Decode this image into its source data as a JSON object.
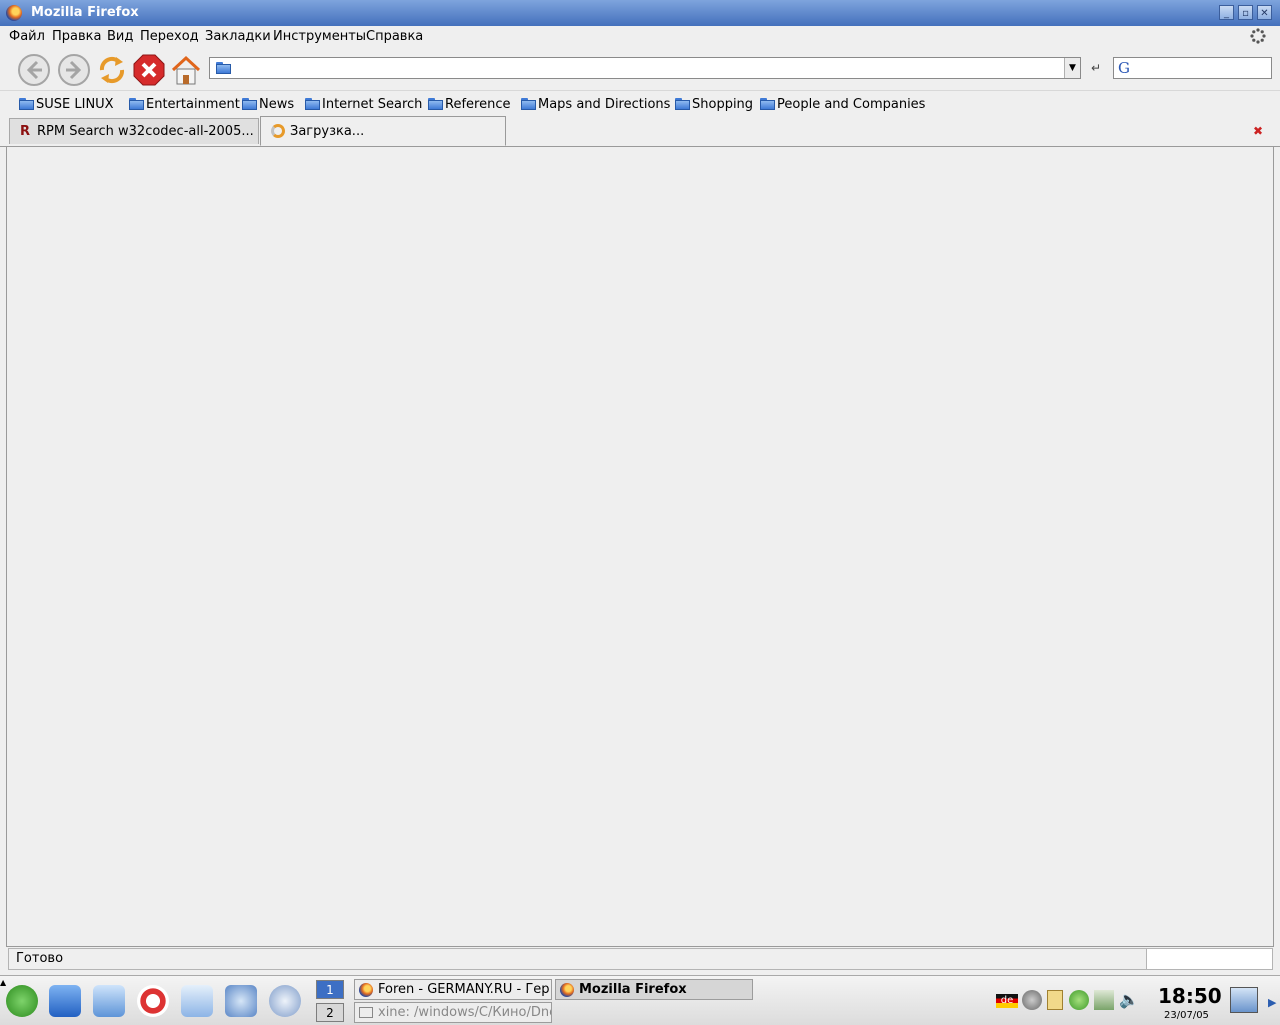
{
  "window": {
    "title": "Mozilla Firefox"
  },
  "menu": [
    "Файл",
    "Правка",
    "Вид",
    "Переход",
    "Закладки",
    "Инструменты",
    "Справка"
  ],
  "nav": {
    "url_value": "",
    "search_value": ""
  },
  "bookmarks": [
    "SUSE LINUX",
    "Entertainment",
    "News",
    "Internet Search",
    "Reference",
    "Maps and Directions",
    "Shopping",
    "People and Companies"
  ],
  "tabs": [
    {
      "label": "RPM Search w32codec-all-2005...",
      "active": false
    },
    {
      "label": "Загрузка...",
      "active": true
    }
  ],
  "status": {
    "text": "Готово"
  },
  "taskbar": {
    "pager": [
      "1",
      "2"
    ],
    "tasks": [
      {
        "label": "Foren - GERMANY.RU - Гер"
      },
      {
        "label": "xine: /windows/C/Кино/Dnev"
      },
      {
        "label": "Mozilla Firefox"
      }
    ],
    "keyboard_layout": "de",
    "clock": "18:50",
    "date": "23/07/05"
  },
  "colors": {
    "titlebar": "#4470bc",
    "stop": "#d62b2b",
    "reload": "#e79a2a",
    "active_task": "#d6d6d6"
  }
}
